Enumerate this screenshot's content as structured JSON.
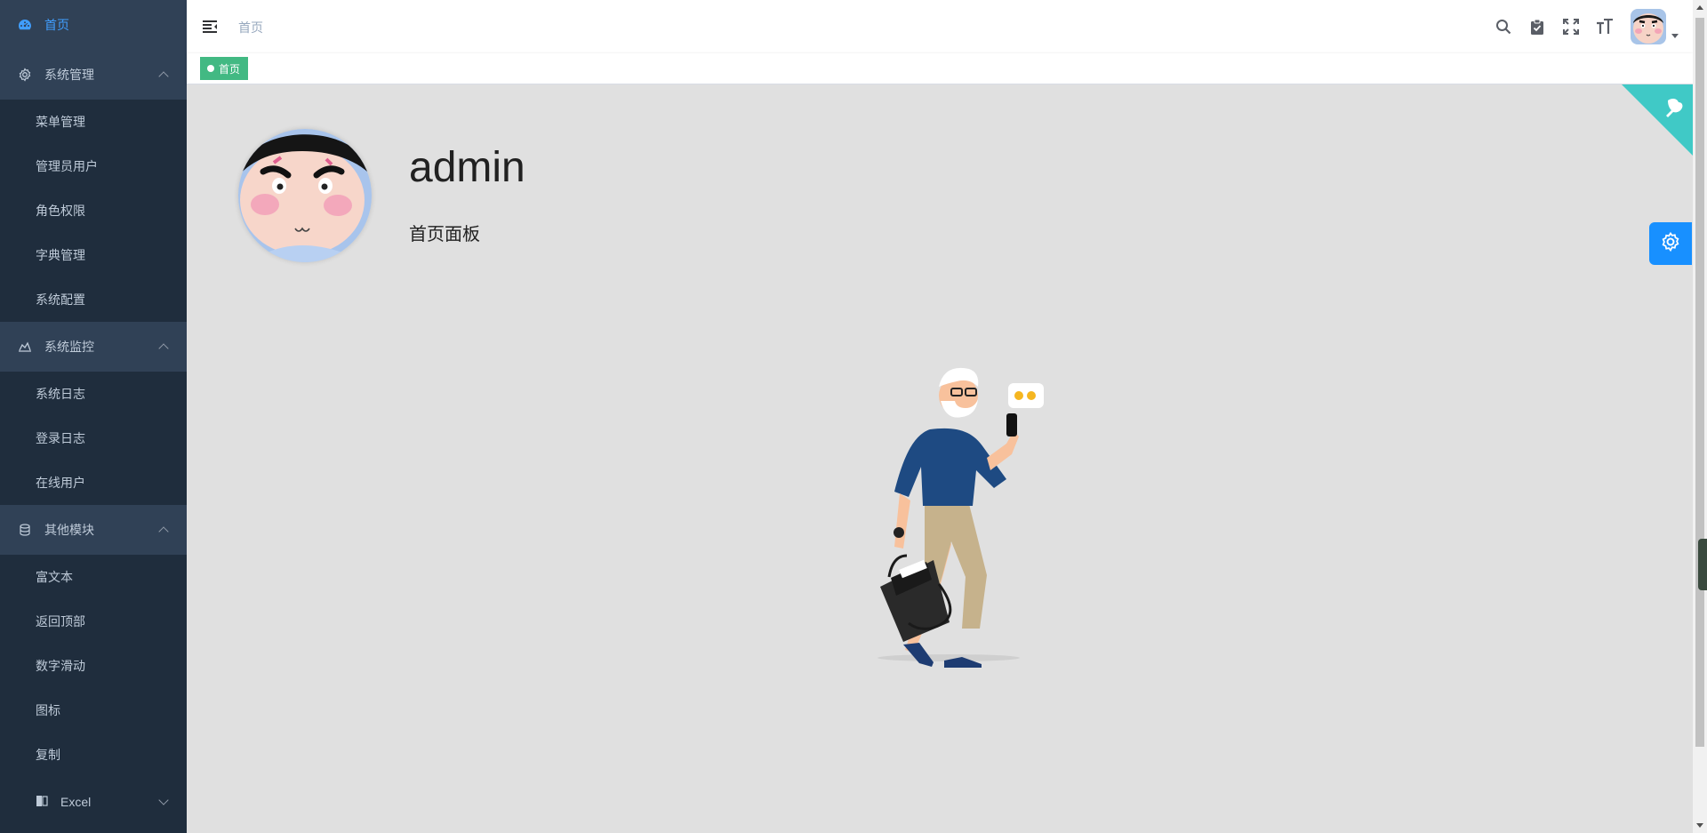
{
  "sidebar": {
    "home": {
      "label": "首页",
      "icon": "dashboard-icon"
    },
    "groups": [
      {
        "label": "系统管理",
        "icon": "gear-icon",
        "expanded": true,
        "items": [
          "菜单管理",
          "管理员用户",
          "角色权限",
          "字典管理",
          "系统配置"
        ]
      },
      {
        "label": "系统监控",
        "icon": "monitor-icon",
        "expanded": true,
        "items": [
          "系统日志",
          "登录日志",
          "在线用户"
        ]
      },
      {
        "label": "其他模块",
        "icon": "module-icon",
        "expanded": true,
        "items": [
          "富文本",
          "返回顶部",
          "数字滑动",
          "图标",
          "复制"
        ]
      }
    ],
    "excel": {
      "label": "Excel",
      "icon": "excel-icon",
      "expanded": false
    }
  },
  "navbar": {
    "breadcrumb": "首页",
    "icons": [
      "search-icon",
      "clipboard-icon",
      "fullscreen-icon",
      "font-size-icon"
    ]
  },
  "tags": [
    {
      "label": "首页",
      "active": true,
      "color": "#42b983"
    }
  ],
  "profile": {
    "name": "admin",
    "role": "首页面板"
  },
  "colors": {
    "sidebar_bg": "#1f2d3d",
    "sidebar_group_bg": "#304156",
    "sidebar_text": "#bfcbd9",
    "active": "#409eff",
    "tag": "#42b983",
    "settings": "#1890ff",
    "github_corner": "#40c9c6"
  }
}
